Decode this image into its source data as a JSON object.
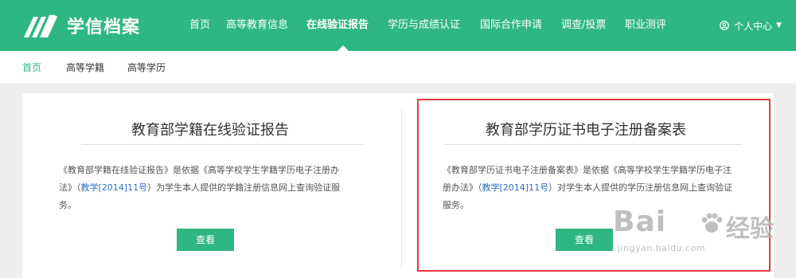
{
  "header": {
    "logo_text": "学信档案",
    "nav": [
      {
        "label": "首页"
      },
      {
        "label": "高等教育信息"
      },
      {
        "label": "在线验证报告",
        "active": true
      },
      {
        "label": "学历与成绩认证"
      },
      {
        "label": "国际合作申请"
      },
      {
        "label": "调查/投票"
      },
      {
        "label": "职业测评"
      }
    ],
    "user_center": "个人中心"
  },
  "subnav": {
    "items": [
      {
        "label": "首页",
        "active": true
      },
      {
        "label": "高等学籍"
      },
      {
        "label": "高等学历"
      }
    ]
  },
  "panels": [
    {
      "title": "教育部学籍在线验证报告",
      "desc_line1": "《教育部学籍在线验证报告》是依据《高等学校学生学籍学历电子注册办",
      "desc_line2_pre": "法》（",
      "desc_link": "教学[2014]11号",
      "desc_line2_post": "）为学生本人提供的学籍注册信息网上查询验证服",
      "desc_line3": "务。",
      "button": "查看"
    },
    {
      "title": "教育部学历证书电子注册备案表",
      "desc_line1": "《教育部学历证书电子注册备案表》是依据《高等学校学生学籍学历电子注",
      "desc_line2_pre": "册办法》（",
      "desc_link": "教学[2014]11号",
      "desc_line2_post": "）对学生本人提供的学历注册信息网上查询验证",
      "desc_line3": "服务。",
      "button": "查看"
    }
  ],
  "watermark": {
    "brand_pre": "Bai",
    "brand_post": "经验",
    "url": "jingyan.baidu.com"
  },
  "colors": {
    "brand_green": "#2fb783",
    "link_blue": "#2a70c4",
    "highlight_red": "#e43a3a"
  }
}
